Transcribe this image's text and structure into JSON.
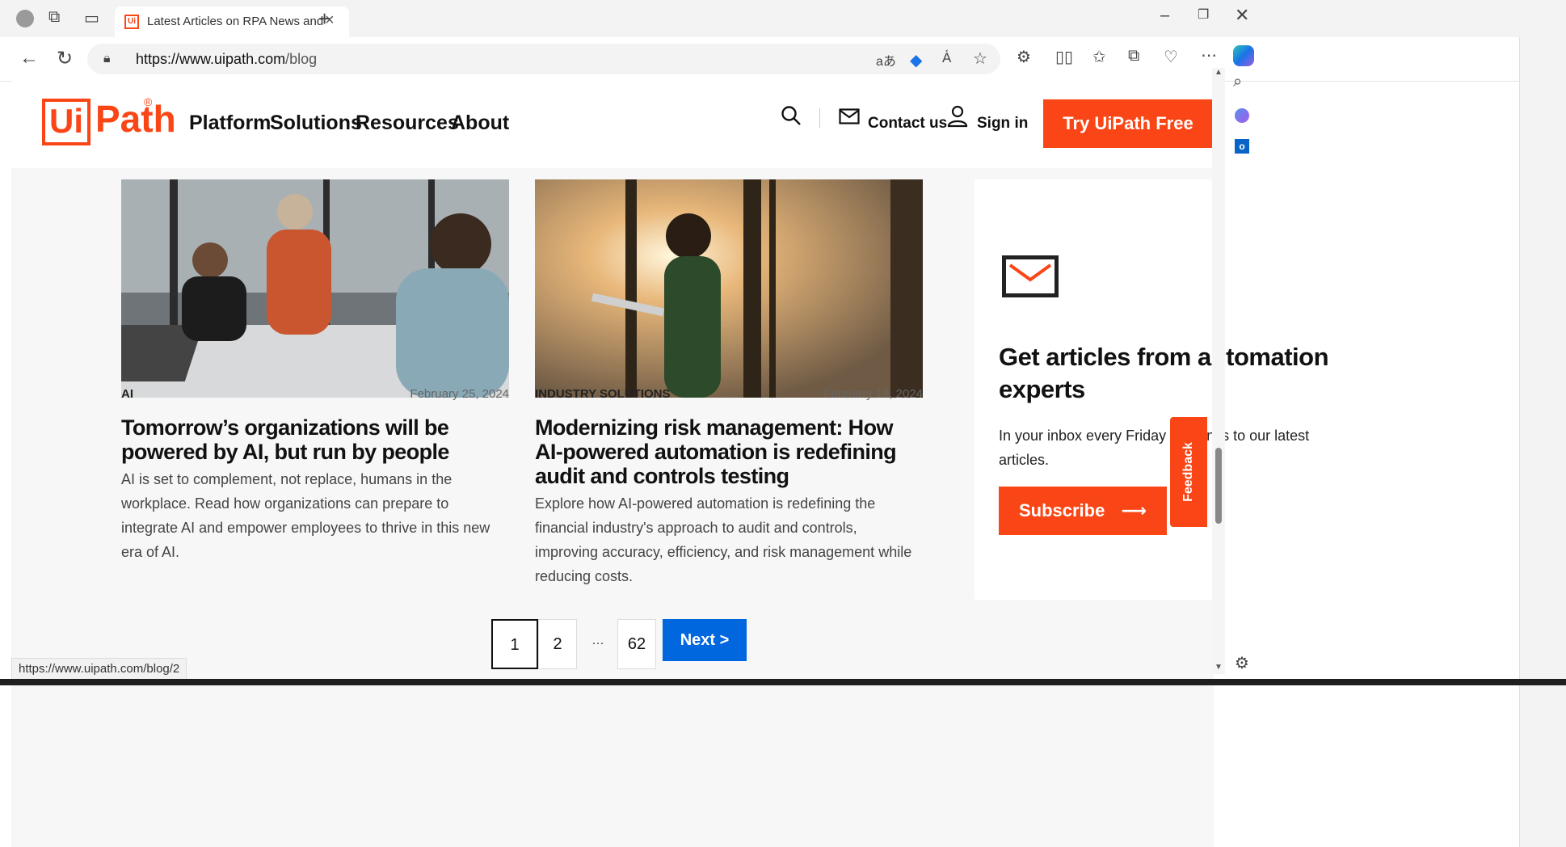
{
  "browser": {
    "tab_title": "Latest Articles on RPA News and",
    "url_host": "https://www.uipath.com",
    "url_path": "/blog",
    "status_url": "https://www.uipath.com/blog/2"
  },
  "header": {
    "logo_ui": "Ui",
    "logo_path": "Path",
    "logo_reg": "®",
    "nav": [
      "Platform",
      "Solutions",
      "Resources",
      "About"
    ],
    "contact": "Contact us",
    "signin": "Sign in",
    "try_button": "Try UiPath Free"
  },
  "articles": [
    {
      "category": "AI",
      "date": "February 25, 2024",
      "title": "Tomorrow’s organizations will be powered by AI, but run by people",
      "excerpt": "AI is set to complement, not replace, humans in the workplace. Read how organizations can prepare to integrate AI and empower employees to thrive in this new era of AI."
    },
    {
      "category": "INDUSTRY SOLUTIONS",
      "date": "February 19, 2024",
      "title": "Modernizing risk management: How AI-powered automation is redefining audit and controls testing",
      "excerpt": "Explore how AI-powered automation is redefining the financial industry's approach to audit and controls, improving accuracy, efficiency, and risk management while reducing costs."
    }
  ],
  "newsletter": {
    "title": "Get articles from automation experts",
    "text": "In your inbox every Friday with links to our latest articles.",
    "button": "Subscribe"
  },
  "feedback": "Feedback",
  "pagination": {
    "pages": [
      "1",
      "2",
      "…",
      "62"
    ],
    "next": "Next  >"
  },
  "colors": {
    "brand": "#fa4616",
    "next_blue": "#0067df"
  }
}
